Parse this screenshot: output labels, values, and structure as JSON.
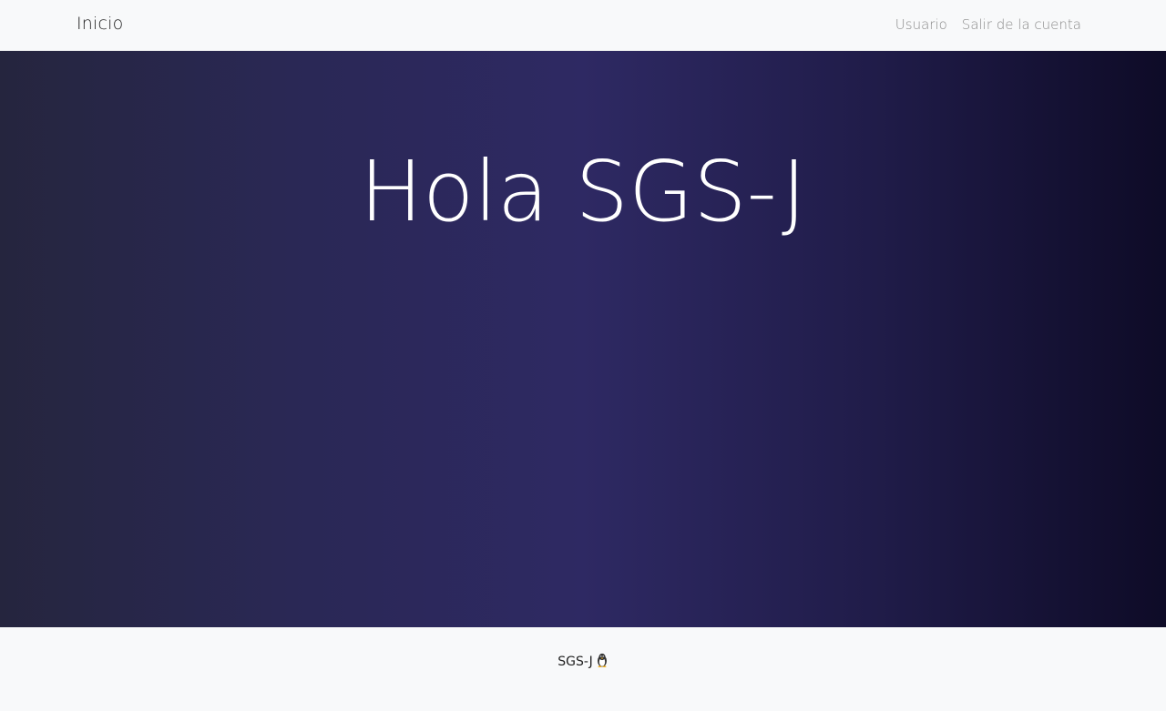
{
  "navbar": {
    "brand": "Inicio",
    "links": [
      {
        "label": "Usuario"
      },
      {
        "label": "Salir de la cuenta"
      }
    ]
  },
  "hero": {
    "title": "Hola SGS-J",
    "gradient_colors": [
      "#25253e",
      "#2e2963",
      "#0e0b27"
    ]
  },
  "footer": {
    "text": "SGS-J",
    "icon": "penguin-icon"
  }
}
